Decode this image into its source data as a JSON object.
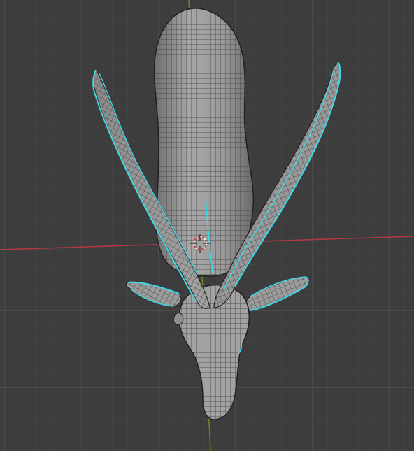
{
  "viewport": {
    "background": "#3d3d3d",
    "grid_minor_color": "#474747",
    "grid_major_color": "#535353",
    "x_axis_color": "#b33a43",
    "y_axis_color": "#6a8a1c"
  },
  "mesh": {
    "fill_color": "#8e8e8e",
    "wire_color": "#333333",
    "selected_edge_color": "#3fd8e6"
  },
  "cursor": {
    "icon": "3d-cursor-icon",
    "ring_color_a": "#e33b3b",
    "ring_color_b": "#ffffff"
  }
}
